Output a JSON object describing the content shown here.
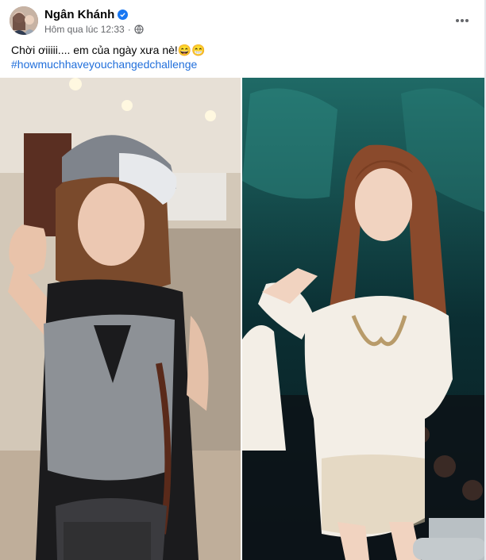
{
  "post": {
    "author": "Ngân Khánh",
    "timestamp": "Hôm qua lúc 12:33",
    "separator": "·",
    "caption": "Chời ơiiiii.... em của ngày xưa nè!😄😁",
    "hashtag": "#howmuchhaveyouchangedchallenge"
  },
  "icons": {
    "verified": "verified-badge-icon",
    "privacy": "globe-icon",
    "more": "more-dots-icon"
  },
  "colors": {
    "link": "#216fdb",
    "verified": "#1877f2",
    "secondary_text": "#65676b"
  }
}
